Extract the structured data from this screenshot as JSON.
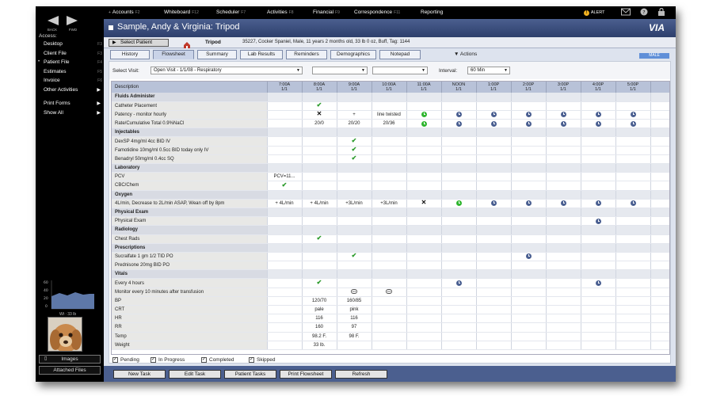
{
  "topmenu": [
    {
      "label": "Accounts",
      "key": "F2"
    },
    {
      "label": "Whiteboard",
      "key": "F12"
    },
    {
      "label": "Scheduler",
      "key": "F7"
    },
    {
      "label": "Activities",
      "key": "F8"
    },
    {
      "label": "Financial",
      "key": "F9"
    },
    {
      "label": "Correspondence",
      "key": "F11"
    },
    {
      "label": "Reporting",
      "key": ""
    }
  ],
  "alert_label": "ALERT",
  "sidebar": {
    "back": "BACK",
    "fwd": "FWD",
    "access_title": "Access:",
    "items": [
      {
        "label": "Desktop",
        "key": "F3"
      },
      {
        "label": "Client File",
        "key": "F3"
      },
      {
        "label": "Patient File",
        "key": "F4"
      },
      {
        "label": "Estimates",
        "key": "F5"
      },
      {
        "label": "Invoice",
        "key": "F6"
      },
      {
        "label": "Other Activities",
        "key": ""
      },
      {
        "label": "Print Forms",
        "key": ""
      },
      {
        "label": "Show All",
        "key": ""
      }
    ],
    "weight_label": "Wt : 33 lb",
    "weight_ticks": [
      "60",
      "40",
      "20",
      "0"
    ],
    "images_button": "Images",
    "attached_files_button": "Attached Files"
  },
  "title": "Sample, Andy & Virginia:  Tripod",
  "logo": "VIA",
  "patient_bar": {
    "select_patient": "Select Patient",
    "name": "Tripod",
    "info": "35227,  Cocker Spaniel,  Male,  11 years 2 months old,  33 lb 0 oz,  Buff,  Tag: 1144"
  },
  "tabs": [
    "History",
    "Flowsheet",
    "Summary",
    "Lab Results",
    "Reminders",
    "Demographics",
    "Notepad"
  ],
  "actions_label": "Actions",
  "sex_badge": "MALE",
  "filters": {
    "select_visit_label": "Select Visit:",
    "visit_value": "Open Visit - 1/1/08  -  Respiratory",
    "interval_label": "Interval:",
    "interval_value": "60 Min"
  },
  "grid": {
    "description_header": "Description",
    "columns": [
      {
        "time": "7:00A",
        "date": "1/1"
      },
      {
        "time": "8:00A",
        "date": "1/1"
      },
      {
        "time": "9:00A",
        "date": "1/1"
      },
      {
        "time": "10:00A",
        "date": "1/1"
      },
      {
        "time": "11:00A",
        "date": "1/1"
      },
      {
        "time": "NOON",
        "date": "1/1"
      },
      {
        "time": "1:00P",
        "date": "1/1"
      },
      {
        "time": "2:00P",
        "date": "1/1"
      },
      {
        "time": "3:00P",
        "date": "1/1"
      },
      {
        "time": "4:00P",
        "date": "1/1"
      },
      {
        "time": "5:00P",
        "date": "1/1"
      }
    ],
    "rows": [
      {
        "type": "cat",
        "label": "Fluids Administer"
      },
      {
        "type": "item",
        "label": "Catheter Placement",
        "cells": [
          "",
          "check",
          "",
          "",
          "",
          "",
          "",
          "",
          "",
          "",
          ""
        ]
      },
      {
        "type": "item",
        "label": "Patency - monitor hourly",
        "cells": [
          "",
          "x",
          "+",
          "line twisted",
          "clock-green",
          "clock",
          "clock",
          "clock",
          "clock",
          "clock",
          "clock"
        ]
      },
      {
        "type": "item",
        "label": "Rate/Cumulative Total  0.9%NaCl",
        "cells": [
          "",
          "20/0",
          "20/20",
          "20/36",
          "clock-green",
          "clock",
          "clock",
          "clock",
          "clock",
          "clock",
          "clock"
        ]
      },
      {
        "type": "cat",
        "label": "Injectables"
      },
      {
        "type": "item",
        "label": "DexSP 4mg/ml  4cc BID IV",
        "cells": [
          "",
          "",
          "check",
          "",
          "",
          "",
          "",
          "",
          "",
          "",
          ""
        ]
      },
      {
        "type": "item",
        "label": "Famotidine 10mg/ml  0.5cc BID today only IV",
        "cells": [
          "",
          "",
          "check",
          "",
          "",
          "",
          "",
          "",
          "",
          "",
          ""
        ]
      },
      {
        "type": "item",
        "label": "Benadryl 50mg/ml 0.4cc SQ",
        "cells": [
          "",
          "",
          "check",
          "",
          "",
          "",
          "",
          "",
          "",
          "",
          ""
        ]
      },
      {
        "type": "cat",
        "label": "Laboratory"
      },
      {
        "type": "item",
        "label": "PCV",
        "cells": [
          "PCV=11...",
          "",
          "",
          "",
          "",
          "",
          "",
          "",
          "",
          "",
          ""
        ]
      },
      {
        "type": "item",
        "label": "CBC/Chem",
        "cells": [
          "check",
          "",
          "",
          "",
          "",
          "",
          "",
          "",
          "",
          "",
          ""
        ]
      },
      {
        "type": "cat",
        "label": "Oxygen"
      },
      {
        "type": "item",
        "label": "4L/min, Decrease to 2L/min ASAP, Wean off by 8pm",
        "cells": [
          "+ 4L/min",
          "+ 4L/min",
          "+3L/min",
          "+3L/min",
          "x",
          "clock-green",
          "clock",
          "clock",
          "clock",
          "clock",
          "clock"
        ]
      },
      {
        "type": "cat",
        "label": "Physical Exam"
      },
      {
        "type": "item",
        "label": "Physical Exam",
        "cells": [
          "",
          "",
          "",
          "",
          "",
          "",
          "",
          "",
          "",
          "clock",
          ""
        ]
      },
      {
        "type": "cat",
        "label": "Radiology"
      },
      {
        "type": "item",
        "label": "Chest Rads",
        "cells": [
          "",
          "check",
          "",
          "",
          "",
          "",
          "",
          "",
          "",
          "",
          ""
        ]
      },
      {
        "type": "cat",
        "label": "Prescriptions"
      },
      {
        "type": "item",
        "label": "Sucralfate  1 gm 1/2 TID PO",
        "cells": [
          "",
          "",
          "check",
          "",
          "",
          "",
          "",
          "clock",
          "",
          "",
          ""
        ]
      },
      {
        "type": "item",
        "label": "Prednisone 20mg BID PO",
        "cells": [
          "",
          "",
          "",
          "",
          "",
          "",
          "",
          "",
          "",
          "",
          ""
        ]
      },
      {
        "type": "cat",
        "label": "Vitals"
      },
      {
        "type": "item",
        "label": "Every 4 hours",
        "cells": [
          "",
          "check",
          "",
          "",
          "",
          "clock",
          "",
          "",
          "",
          "clock",
          ""
        ]
      },
      {
        "type": "item",
        "label": "Monitor every 10 minutes after transfusion",
        "cells": [
          "",
          "",
          "dots",
          "dots",
          "",
          "",
          "",
          "",
          "",
          "",
          ""
        ]
      },
      {
        "type": "item",
        "label": "BP",
        "cells": [
          "",
          "120/70",
          "160/85",
          "",
          "",
          "",
          "",
          "",
          "",
          "",
          ""
        ]
      },
      {
        "type": "item",
        "label": "CRT",
        "cells": [
          "",
          "pale",
          "pink",
          "",
          "",
          "",
          "",
          "",
          "",
          "",
          ""
        ]
      },
      {
        "type": "item",
        "label": "HR",
        "cells": [
          "",
          "116",
          "116",
          "",
          "",
          "",
          "",
          "",
          "",
          "",
          ""
        ]
      },
      {
        "type": "item",
        "label": "RR",
        "cells": [
          "",
          "160",
          "97",
          "",
          "",
          "",
          "",
          "",
          "",
          "",
          ""
        ]
      },
      {
        "type": "item",
        "label": "Temp",
        "cells": [
          "",
          "98.2 F.",
          "98 F.",
          "",
          "",
          "",
          "",
          "",
          "",
          "",
          ""
        ]
      },
      {
        "type": "item",
        "label": "Weight",
        "cells": [
          "",
          "33 lb.",
          "",
          "",
          "",
          "",
          "",
          "",
          "",
          "",
          ""
        ]
      }
    ]
  },
  "legend": [
    {
      "label": "Pending",
      "checked": true
    },
    {
      "label": "In Progress",
      "checked": true
    },
    {
      "label": "Completed",
      "checked": true
    },
    {
      "label": "Skipped",
      "checked": true
    }
  ],
  "bottom_buttons": [
    "New Task",
    "Edit Task",
    "Patient Tasks",
    "Print Flowsheet",
    "Refresh"
  ],
  "colors": {
    "title_bar": "#4b5f8f",
    "check": "#2a9a2a",
    "clock": "#4a5f91",
    "clock_active": "#2fb52f",
    "badge": "#5f8fd8"
  }
}
